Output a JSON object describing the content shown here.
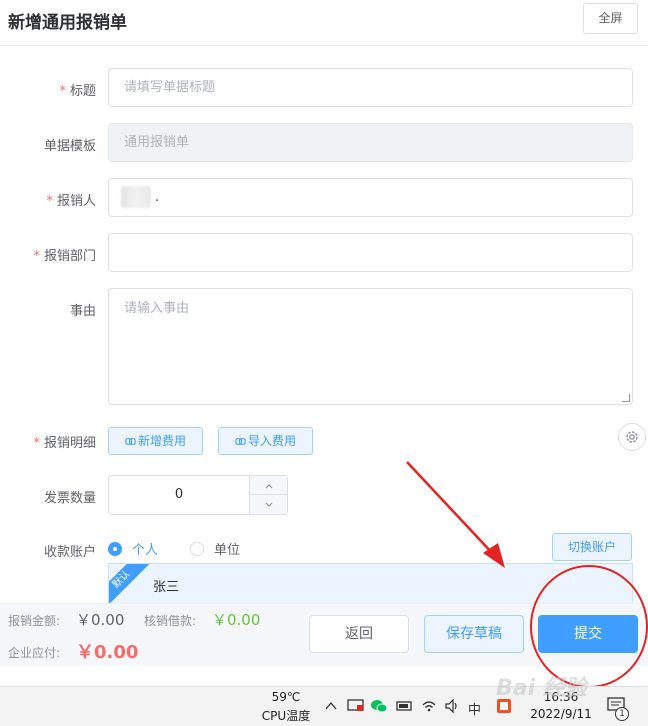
{
  "header": {
    "title": "新增通用报销单",
    "fullscreen_label": "全屏"
  },
  "form": {
    "title_field": {
      "label": "标题",
      "placeholder": "请填写单据标题"
    },
    "template_field": {
      "label": "单据模板",
      "value": "通用报销单"
    },
    "reporter_field": {
      "label": "报销人",
      "value": "."
    },
    "department_field": {
      "label": "报销部门",
      "value": ""
    },
    "reason_field": {
      "label": "事由",
      "placeholder": "请输入事由"
    },
    "detail_field": {
      "label": "报销明细",
      "add_label": "新增费用",
      "import_label": "导入费用"
    },
    "invoice_field": {
      "label": "发票数量",
      "value": "0"
    },
    "account_field": {
      "label": "收款账户",
      "options": [
        "个人",
        "单位"
      ],
      "selected": "个人",
      "switch_label": "切换账户",
      "default_badge": "默认",
      "account_name": "张三"
    }
  },
  "footer": {
    "amount_label": "报销金额:",
    "amount_value": "￥0.00",
    "offset_label": "核销借款:",
    "offset_value": "￥0.00",
    "payable_label": "企业应付:",
    "payable_value": "￥0.00",
    "back_label": "返回",
    "draft_label": "保存草稿",
    "submit_label": "提交"
  },
  "taskbar": {
    "temp_value": "59℃",
    "temp_label": "CPU温度",
    "ime_label": "中",
    "time": "16:36",
    "date": "2022/9/11",
    "notification_count": "1",
    "watermark": "Bai 经验"
  },
  "colors": {
    "accent": "#409eff",
    "required": "#f56c6c",
    "danger": "#f56c6c",
    "success": "#67c23a",
    "annotation": "#e52222"
  }
}
